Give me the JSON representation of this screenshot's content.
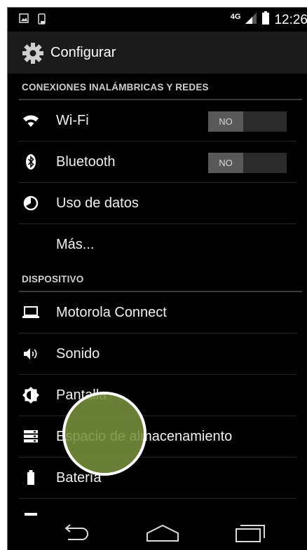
{
  "status_bar": {
    "network_label": "4G",
    "time": "12:26",
    "icons": [
      "image-notification-icon",
      "phone-notification-icon",
      "signal-icon",
      "battery-icon"
    ]
  },
  "action_bar": {
    "title": "Configurar",
    "icon": "settings-gear-icon"
  },
  "sections": {
    "wireless": {
      "header": "CONEXIONES INALÁMBRICAS Y REDES",
      "items": [
        {
          "label": "Wi-Fi",
          "icon": "wifi-icon",
          "toggle": "NO"
        },
        {
          "label": "Bluetooth",
          "icon": "bluetooth-icon",
          "toggle": "NO"
        },
        {
          "label": "Uso de datos",
          "icon": "data-usage-icon"
        },
        {
          "label": "Más..."
        }
      ]
    },
    "device": {
      "header": "DISPOSITIVO",
      "items": [
        {
          "label": "Motorola Connect",
          "icon": "laptop-icon"
        },
        {
          "label": "Sonido",
          "icon": "volume-icon"
        },
        {
          "label": "Pantalla",
          "icon": "brightness-icon"
        },
        {
          "label": "Espacio de almacenamiento",
          "icon": "storage-icon"
        },
        {
          "label": "Batería",
          "icon": "battery-icon"
        }
      ]
    }
  },
  "nav_bar": {
    "buttons": [
      "back-icon",
      "home-icon",
      "recent-apps-icon"
    ]
  },
  "colors": {
    "background": "#000000",
    "action_bar": "#1b1b1b",
    "text": "#f0f0f0",
    "toggle_off": "#595959",
    "touch_indicator": "#78913c"
  }
}
